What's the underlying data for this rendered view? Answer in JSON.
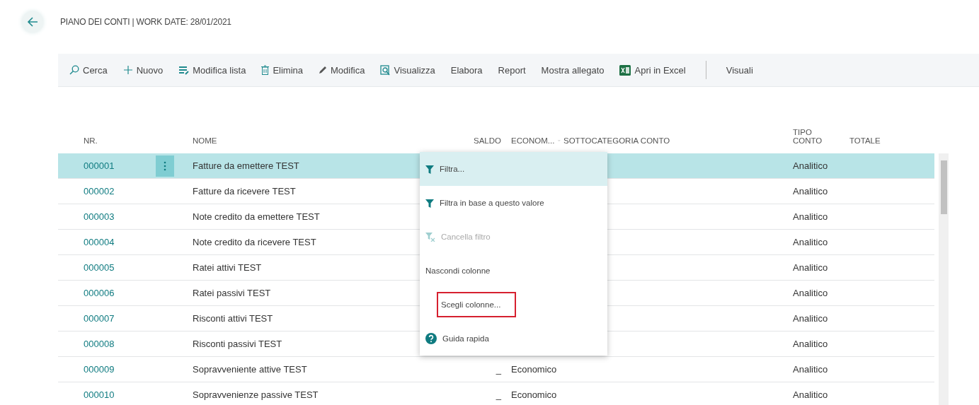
{
  "page": {
    "title": "PIANO DEI CONTI | WORK DATE: 28/01/2021"
  },
  "toolbar": [
    {
      "label": "Cerca",
      "kind": "search"
    },
    {
      "label": "Nuovo",
      "kind": "add"
    },
    {
      "label": "Modifica lista",
      "kind": "listedit"
    },
    {
      "label": "Elimina",
      "kind": "delete"
    },
    {
      "label": "Modifica",
      "kind": "edit"
    },
    {
      "label": "Visualizza",
      "kind": "view"
    },
    {
      "label": "Elabora",
      "kind": "text"
    },
    {
      "label": "Report",
      "kind": "text"
    },
    {
      "label": "Mostra allegato",
      "kind": "text"
    },
    {
      "label": "Apri in Excel",
      "kind": "excel"
    },
    {
      "label": "Visuali",
      "kind": "separated"
    }
  ],
  "table": {
    "columns": [
      "NR.",
      "NOME",
      "SALDO",
      "ECONOM...",
      "SOTTOCATEGORIA CONTO",
      "TIPO CONTO",
      "TOTALE"
    ],
    "rows": [
      {
        "nr": "000001",
        "nome": "Fatture da emettere TEST",
        "tipo_conto": "Analitico",
        "selected": true
      },
      {
        "nr": "000002",
        "nome": "Fatture da ricevere TEST",
        "tipo_conto": "Analitico",
        "selected": false
      },
      {
        "nr": "000003",
        "nome": "Note credito da emettere TEST",
        "tipo_conto": "Analitico",
        "selected": false
      },
      {
        "nr": "000004",
        "nome": "Note credito da ricevere TEST",
        "tipo_conto": "Analitico",
        "selected": false
      },
      {
        "nr": "000005",
        "nome": "Ratei attivi TEST",
        "tipo_conto": "Analitico",
        "selected": false
      },
      {
        "nr": "000006",
        "nome": "Ratei passivi TEST",
        "tipo_conto": "Analitico",
        "selected": false
      },
      {
        "nr": "000007",
        "nome": "Risconti attivi TEST",
        "tipo_conto": "Analitico",
        "selected": false
      },
      {
        "nr": "000008",
        "nome": "Risconti passivi TEST",
        "tipo_conto": "Analitico",
        "selected": false
      },
      {
        "nr": "000009",
        "nome": "Sopravveniente attive TEST",
        "saldo": "_",
        "economico": "Economico",
        "tipo_conto": "Analitico",
        "selected": false
      },
      {
        "nr": "000010",
        "nome": "Sopravvenienze passive TEST",
        "saldo": "_",
        "economico": "Economico",
        "tipo_conto": "Analitico",
        "selected": false
      }
    ]
  },
  "context_menu": [
    {
      "label": "Filtra...",
      "kind": "filter",
      "selected": true,
      "disabled": false,
      "outlined": false
    },
    {
      "label": "Filtra in base a questo valore",
      "kind": "filter",
      "selected": false,
      "disabled": false,
      "outlined": false
    },
    {
      "label": "Cancella filtro",
      "kind": "unfilter",
      "selected": false,
      "disabled": true,
      "outlined": false
    },
    {
      "label": "Nascondi colonne",
      "kind": "text",
      "selected": false,
      "disabled": false,
      "outlined": false
    },
    {
      "label": "Scegli colonne...",
      "kind": "text",
      "selected": false,
      "disabled": false,
      "outlined": true
    },
    {
      "label": "Guida rapida",
      "kind": "help",
      "selected": false,
      "disabled": false,
      "outlined": false
    }
  ]
}
